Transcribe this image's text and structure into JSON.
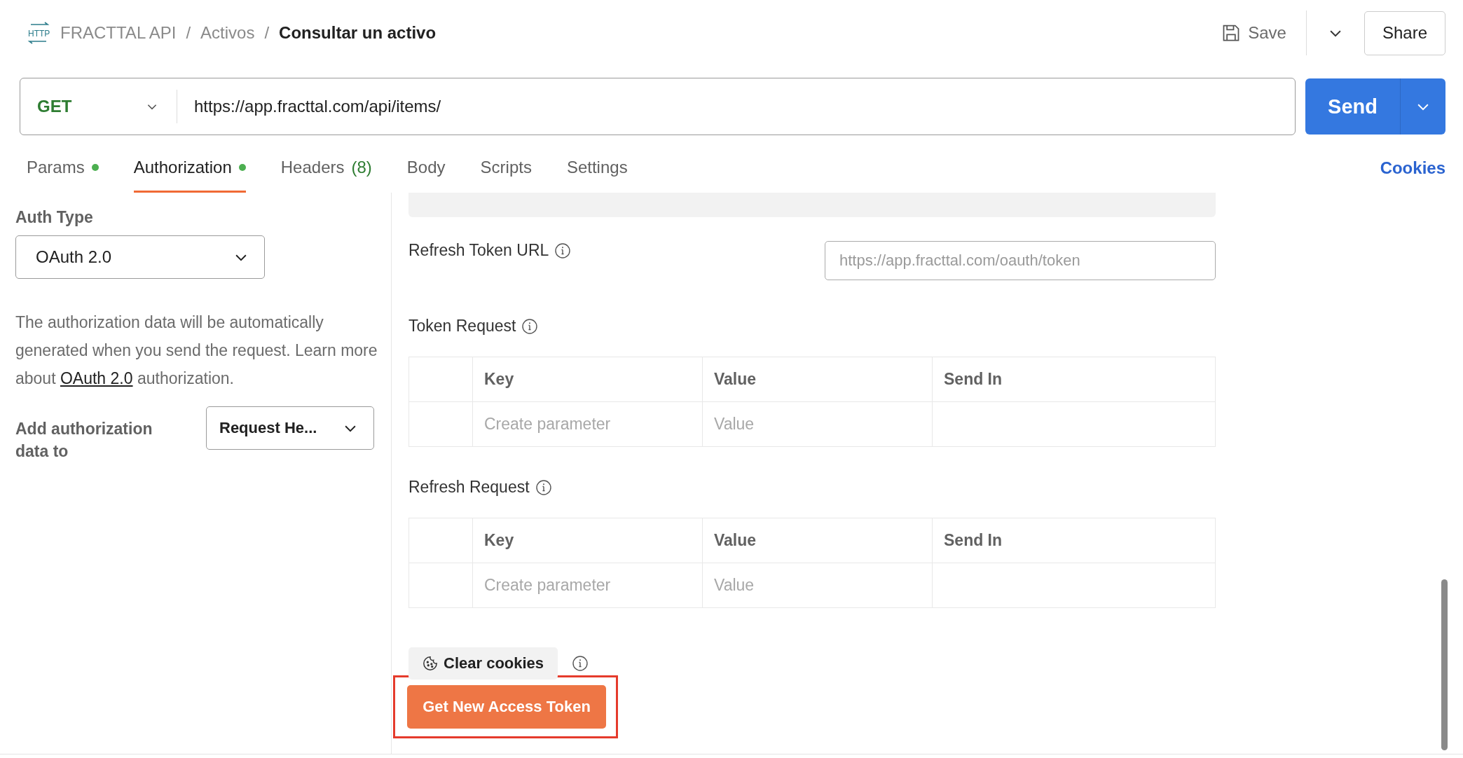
{
  "breadcrumb": {
    "items": [
      "FRACTTAL API",
      "Activos"
    ],
    "current": "Consultar un activo",
    "icon_text": "HTTP",
    "separator": "/"
  },
  "toolbar": {
    "save": "Save",
    "share": "Share"
  },
  "request": {
    "method": "GET",
    "url": "https://app.fracttal.com/api/items/",
    "send": "Send"
  },
  "tabs": [
    {
      "label": "Params",
      "dot": true,
      "selected": false
    },
    {
      "label": "Authorization",
      "dot": true,
      "selected": true
    },
    {
      "label": "Headers",
      "dot": false,
      "count": "(8)",
      "selected": false
    },
    {
      "label": "Body",
      "dot": false,
      "selected": false
    },
    {
      "label": "Scripts",
      "dot": false,
      "selected": false
    },
    {
      "label": "Settings",
      "dot": false,
      "selected": false
    }
  ],
  "cookies_link": "Cookies",
  "auth": {
    "type_label": "Auth Type",
    "type_value": "OAuth 2.0",
    "description": "The authorization data will be automatically generated when you send the request. Learn more about ",
    "link": "OAuth 2.0",
    "description_end": " authorization.",
    "add_to_label": "Add authorization data to",
    "add_to_value": "Request He..."
  },
  "refresh_token_url": {
    "label": "Refresh Token URL",
    "placeholder": "https://app.fracttal.com/oauth/token"
  },
  "tables": [
    {
      "title": "Token Request",
      "columns": [
        "Key",
        "Value",
        "Send In"
      ],
      "key_placeholder": "Create parameter",
      "value_placeholder": "Value"
    },
    {
      "title": "Refresh Request",
      "columns": [
        "Key",
        "Value",
        "Send In"
      ],
      "key_placeholder": "Create parameter",
      "value_placeholder": "Value"
    }
  ],
  "clear_cookies": "Clear cookies",
  "get_token": {
    "label": "Get New Access Token",
    "highlighted": true
  }
}
